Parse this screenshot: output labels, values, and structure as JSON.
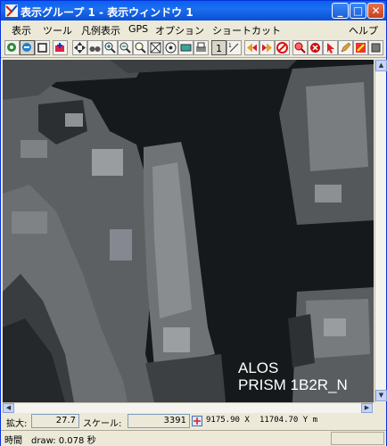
{
  "window": {
    "title": "表示グループ 1 - 表示ウィンドウ 1",
    "minimize_glyph": "_",
    "maximize_glyph": "□",
    "close_glyph": "✕"
  },
  "menu": {
    "items": [
      "表示",
      "ツール",
      "凡例表示",
      "GPS",
      "オプション",
      "ショートカット"
    ],
    "help": "ヘルプ"
  },
  "toolbar": {
    "icons": [
      "zoom-full-icon",
      "redraw-icon",
      "fit-icon",
      "add-layer-icon",
      "pan-icon",
      "binoculars-icon",
      "zoom-in-icon",
      "zoom-out-icon",
      "zoom-box-icon",
      "zoom-extent-icon",
      "globe-icon",
      "measure-icon",
      "print-icon",
      "scale-1-icon",
      "scale-ratio-icon",
      "back-icon",
      "forward-icon",
      "stop-icon",
      "find-icon",
      "close-circle-icon",
      "pointer-icon",
      "pencil-icon",
      "edit-icon",
      "exit-icon"
    ]
  },
  "map": {
    "watermark_line1": "ALOS",
    "watermark_line2": "PRISM 1B2R_N"
  },
  "status": {
    "zoom_label": "拡大:",
    "zoom_value": "27.7",
    "scale_label": "スケール:",
    "scale_value": "3391",
    "coord_x": "9175.90 X",
    "coord_y": "11704.70 Y m",
    "time_label": "時間",
    "draw_text": "draw: 0.078 秒"
  },
  "colors": {
    "titlebar": "#0a5ff0",
    "window_bg": "#ece9d8",
    "image_water": "#16191b"
  }
}
